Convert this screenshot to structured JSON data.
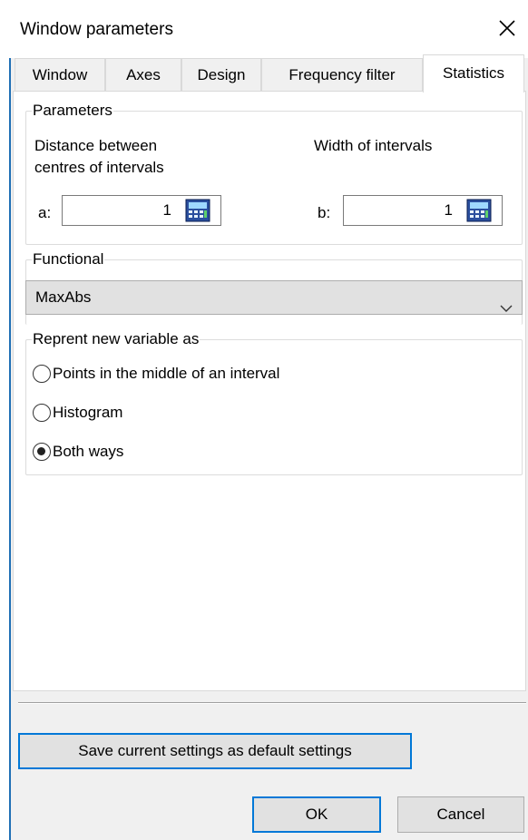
{
  "window": {
    "title": "Window parameters"
  },
  "tabs": [
    {
      "label": "Window"
    },
    {
      "label": "Axes"
    },
    {
      "label": "Design"
    },
    {
      "label": "Frequency filter"
    },
    {
      "label": "Statistics",
      "active": true
    }
  ],
  "parameters": {
    "legend": "Parameters",
    "distance_label_line1": "Distance between",
    "distance_label_line2": "centres of intervals",
    "width_label": "Width of intervals",
    "a_label": "a:",
    "a_value": "1",
    "b_label": "b:",
    "b_value": "1"
  },
  "functional": {
    "legend": "Functional",
    "selected": "MaxAbs"
  },
  "represent": {
    "legend": "Reprent new variable as",
    "options": [
      {
        "label": "Points in the middle of an interval",
        "checked": false
      },
      {
        "label": "Histogram",
        "checked": false
      },
      {
        "label": "Both ways",
        "checked": true
      }
    ]
  },
  "buttons": {
    "save_default": "Save current settings as default settings",
    "ok": "OK",
    "cancel": "Cancel"
  },
  "colors": {
    "focus_border": "#0078d7",
    "window_frame": "#1f6fb5",
    "dialog_bg": "#f0f0f0",
    "button_bg": "#e1e1e1"
  },
  "icons": {
    "close": "close-icon",
    "calculator": "calculator-icon",
    "dropdown": "chevron-down-icon"
  }
}
